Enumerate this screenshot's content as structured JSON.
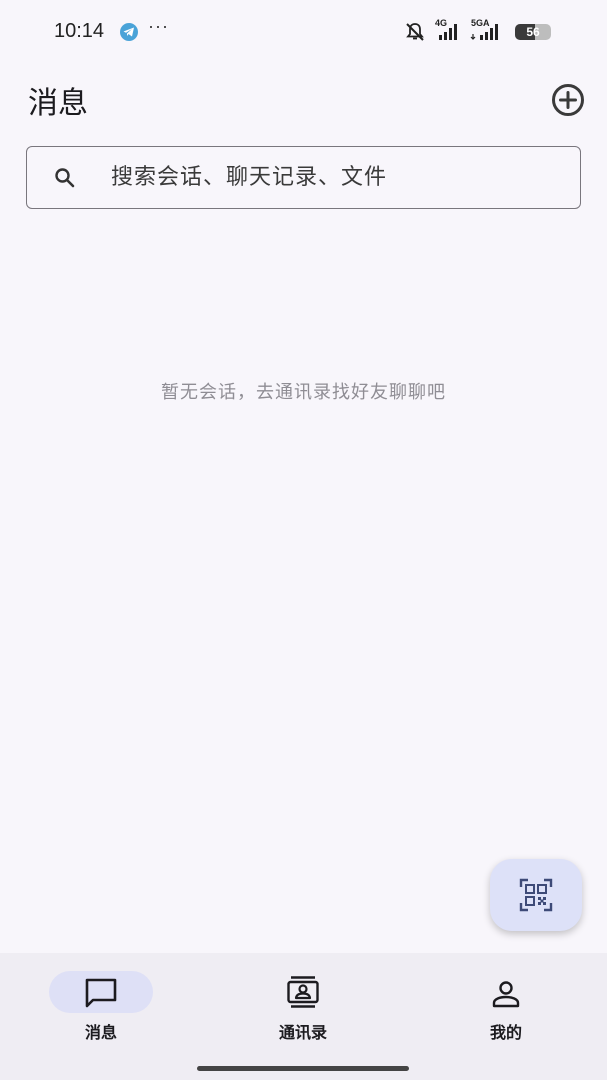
{
  "status_bar": {
    "time": "10:14",
    "more": "···",
    "net1": "4G",
    "net2": "5GA",
    "battery": "56",
    "battery_level": 0.56
  },
  "header": {
    "title": "消息",
    "add_icon": "add-circle-icon"
  },
  "search": {
    "placeholder": "搜索会话、聊天记录、文件",
    "icon": "search-icon"
  },
  "empty_state": {
    "text": "暂无会话，去通讯录找好友聊聊吧"
  },
  "fab": {
    "icon": "qr-code-scan-icon"
  },
  "nav": {
    "items": [
      {
        "label": "消息",
        "icon": "chat-bubble-icon",
        "active": true
      },
      {
        "label": "通讯录",
        "icon": "contacts-icon",
        "active": false
      },
      {
        "label": "我的",
        "icon": "person-icon",
        "active": false
      }
    ]
  },
  "colors": {
    "background": "#f8f6fb",
    "nav_background": "#efedf3",
    "active_pill": "#dee0f6",
    "fab": "#dde1f8",
    "telegram": "#4aa3d8"
  }
}
